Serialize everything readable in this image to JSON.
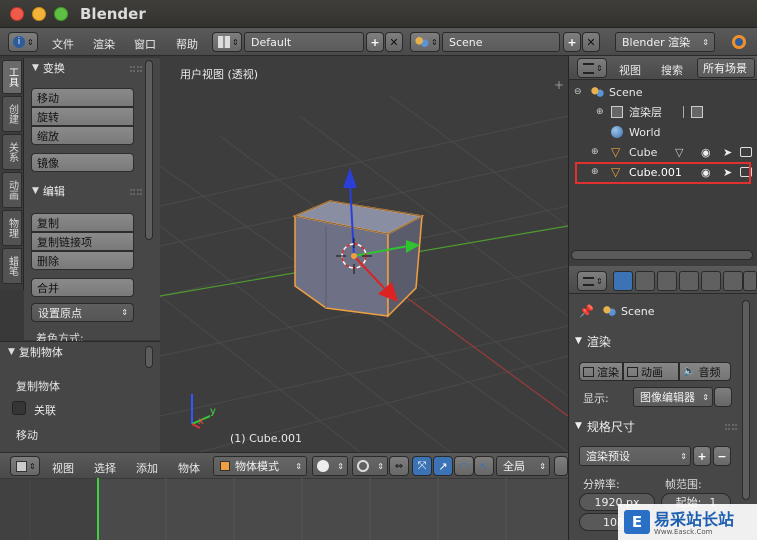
{
  "window": {
    "title": "Blender"
  },
  "info_header": {
    "menus": [
      "文件",
      "渲染",
      "窗口",
      "帮助"
    ],
    "layout": "Default",
    "scene": "Scene",
    "engine": "Blender 渲染"
  },
  "toolshelf": {
    "tabs": [
      "工具",
      "创建",
      "关系",
      "动画",
      "物理",
      "蜡笔"
    ],
    "transform": {
      "header": "变换",
      "buttons": [
        "移动",
        "旋转",
        "缩放"
      ],
      "mirror": "镜像"
    },
    "edit": {
      "header": "编辑",
      "buttons": [
        "复制",
        "复制链接项",
        "删除"
      ],
      "join": "合并",
      "origin": "设置原点",
      "shading": "着色方式:"
    }
  },
  "redo_panel": {
    "header": "复制物体",
    "title": "复制物体",
    "linked_label": "关联",
    "move_label": "移动"
  },
  "viewport": {
    "view_label": "用户视图 (透视)",
    "object_label": "(1) Cube.001",
    "axis_x": "x",
    "axis_y": "y"
  },
  "viewport_header": {
    "menus": [
      "视图",
      "选择",
      "添加",
      "物体"
    ],
    "mode": "物体模式",
    "pivot": "全局"
  },
  "outliner": {
    "view_tab": "视图",
    "search_tab": "搜索",
    "scope": "所有场景",
    "items": [
      {
        "label": "Scene"
      },
      {
        "label": "渲染层"
      },
      {
        "label": "World"
      },
      {
        "label": "Cube"
      },
      {
        "label": "Cube.001"
      }
    ]
  },
  "properties": {
    "context_name": "Scene",
    "render_section": "渲染",
    "render_buttons": [
      "渲染",
      "动画",
      "音频"
    ],
    "display_label": "显示:",
    "display_value": "图像编辑器",
    "dimensions_section": "规格尺寸",
    "preset": "渲染预设",
    "resolution_label": "分辨率:",
    "frame_range_label": "帧范围:",
    "res_x": "1920 px",
    "res_y": "1080",
    "start_label": "起始:",
    "start_value": "1"
  },
  "watermark": {
    "text": "易采站长站",
    "subtext": "Www.Easck.Com"
  },
  "colors": {
    "selection_highlight": "#e03030",
    "active_tab": "#3b73b5",
    "object_outline": "#f0a040"
  }
}
